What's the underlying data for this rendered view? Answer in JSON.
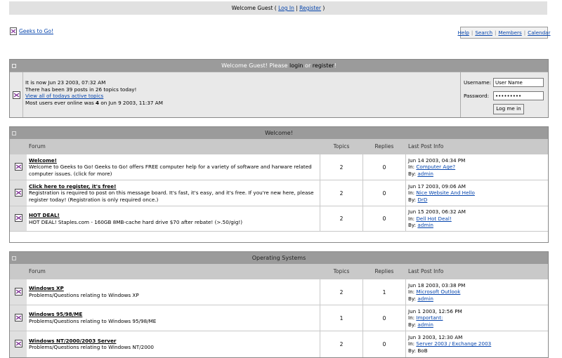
{
  "topbar": {
    "prefix": "Welcome Guest ( ",
    "login": "Log In",
    "sep": " | ",
    "register": "Register",
    "suffix": " )"
  },
  "brand": {
    "name": "Geeks to Go!"
  },
  "toplinks": [
    "Help",
    "Search",
    "Members",
    "Calendar"
  ],
  "welcome": {
    "head_prefix": "Welcome Guest! Please ",
    "head_login": "login",
    "head_or": " or ",
    "head_register": "register",
    "head_suffix": "!",
    "line1": "It is now Jun 23 2003, 07:32 AM",
    "line2": "There has been 39 posts in 26 topics today!",
    "line3": "View all of todays active topics",
    "line4": "Most users ever online was 4 on Jun 9 2003, 11:37 AM",
    "username_label": "Username:",
    "username_value": "User Name",
    "password_label": "Password:",
    "password_value": "•••••••••",
    "login_button": "Log me in"
  },
  "columns": {
    "forum": "Forum",
    "topics": "Topics",
    "replies": "Replies",
    "last": "Last Post Info"
  },
  "categories": [
    {
      "title": "Welcome!",
      "rows": [
        {
          "name": "Welcome!",
          "desc": "Welcome to Geeks to Go! Geeks to Go! offers FREE computer help for a variety of software and harware related computer issues. (click for more)",
          "topics": "2",
          "replies": "0",
          "date": "Jun 14 2003, 04:34 PM",
          "in_label": "In: ",
          "in": "Computer Age?",
          "by_label": "By: ",
          "by": "admin",
          "by_link": true
        },
        {
          "name": "Click here to register, it's free!",
          "desc": "Registration is required to post on this message board. It's fast, it's easy, and it's free. If you're new here, please register today! (Registration is only required once.)",
          "topics": "2",
          "replies": "0",
          "date": "Jun 17 2003, 09:06 AM",
          "in_label": "In: ",
          "in": "Nice Website And Hello",
          "by_label": "By: ",
          "by": "DrD",
          "by_link": true
        },
        {
          "name": "HOT DEAL!",
          "desc": "HOT DEAL! Staples.com - 160GB 8MB-cache hard drive $70 after rebate! (>.50/gig!)",
          "topics": "2",
          "replies": "0",
          "date": "Jun 15 2003, 06:32 AM",
          "in_label": "In: ",
          "in": "Dell Hot Deal!",
          "by_label": "By: ",
          "by": "admin",
          "by_link": true
        }
      ]
    },
    {
      "title": "Operating Systems",
      "rows": [
        {
          "name": "Windows XP",
          "desc": "Problems/Questions relating to Windows XP",
          "topics": "2",
          "replies": "1",
          "date": "Jun 18 2003, 03:38 PM",
          "in_label": "In: ",
          "in": "Microsoft Outlook",
          "by_label": "By: ",
          "by": "admin",
          "by_link": true
        },
        {
          "name": "Windows 95/98/ME",
          "desc": "Problems/Questions relating to Windows 95/98/ME",
          "topics": "1",
          "replies": "0",
          "date": "Jun 1 2003, 12:56 PM",
          "in_label": "In: ",
          "in": "Important:",
          "by_label": "By: ",
          "by": "admin",
          "by_link": true
        },
        {
          "name": "Windows NT/2000/2003 Server",
          "desc": "Problems/Questions relating to Windows NT/2000",
          "topics": "2",
          "replies": "0",
          "date": "Jun 3 2003, 12:30 AM",
          "in_label": "In: ",
          "in": "Server 2003 / Exchange 2003",
          "by_label": "By: ",
          "by": "BoB",
          "by_link": false
        }
      ]
    }
  ]
}
